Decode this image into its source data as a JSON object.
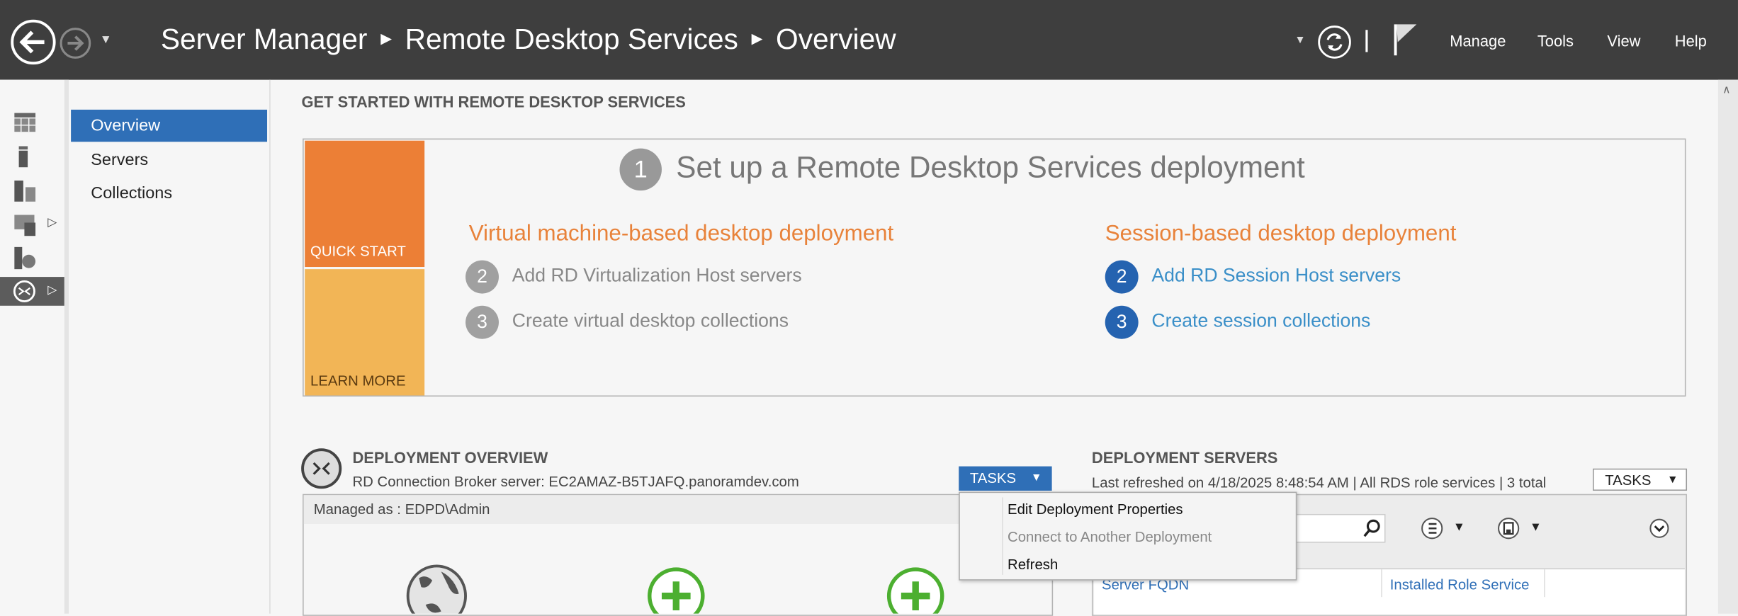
{
  "header": {
    "breadcrumb": [
      "Server Manager",
      "Remote Desktop Services",
      "Overview"
    ],
    "menu": [
      "Manage",
      "Tools",
      "View",
      "Help"
    ]
  },
  "rail": {
    "icons": [
      "dashboard-icon",
      "local-server-icon",
      "all-servers-icon",
      "file-storage-icon",
      "iis-icon",
      "remote-desktop-icon"
    ],
    "selected": "remote-desktop-icon"
  },
  "nav": {
    "items": [
      "Overview",
      "Servers",
      "Collections"
    ],
    "selected": "Overview"
  },
  "get_started": {
    "heading": "GET STARTED WITH REMOTE DESKTOP SERVICES",
    "quick_start": "QUICK START",
    "learn_more": "LEARN MORE",
    "step1_num": "1",
    "step1_title": "Set up a Remote Desktop Services deployment",
    "vm_title": "Virtual machine-based desktop deployment",
    "vm_steps": [
      {
        "num": "2",
        "label": "Add RD Virtualization Host servers"
      },
      {
        "num": "3",
        "label": "Create virtual desktop collections"
      }
    ],
    "session_title": "Session-based desktop deployment",
    "session_steps": [
      {
        "num": "2",
        "label": "Add RD Session Host servers"
      },
      {
        "num": "3",
        "label": "Create session collections"
      }
    ]
  },
  "deployment_overview": {
    "title": "DEPLOYMENT OVERVIEW",
    "subtitle": "RD Connection Broker server: EC2AMAZ-B5TJAFQ.panoramdev.com",
    "tasks": "TASKS",
    "managed_as": "Managed as : EDPD\\Admin",
    "tasks_menu": [
      {
        "label": "Edit Deployment Properties",
        "enabled": true
      },
      {
        "label": "Connect to Another Deployment",
        "enabled": false
      },
      {
        "label": "Refresh",
        "enabled": true
      }
    ]
  },
  "deployment_servers": {
    "title": "DEPLOYMENT SERVERS",
    "subtitle": "Last refreshed on 4/18/2025 8:48:54 AM | All RDS role services | 3 total",
    "tasks": "TASKS",
    "columns": [
      "Server FQDN",
      "Installed Role Service"
    ]
  },
  "colors": {
    "header": "#3e3e3e",
    "accent_blue": "#2f6fb7",
    "quick_start": "#ec7f36",
    "learn_more": "#f2b556",
    "orange_text": "#e8823a",
    "link": "#3a8fc8",
    "green": "#4caf30"
  }
}
